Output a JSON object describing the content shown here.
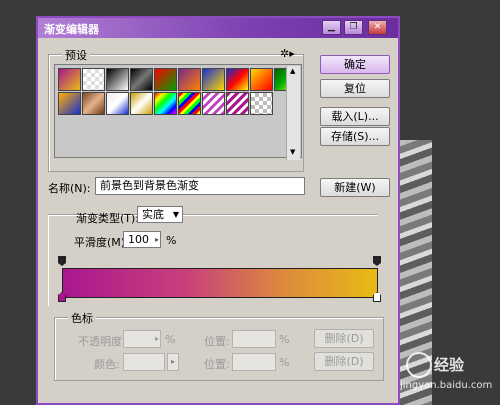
{
  "dialog": {
    "title": "渐变编辑器",
    "titlebar_buttons": [
      "minimize-icon",
      "restore-icon",
      "close-icon"
    ],
    "accent_color": "#7c3fb0"
  },
  "presets": {
    "label": "预设",
    "menu_icon": "gear-icon",
    "swatch_count": 14
  },
  "buttons": {
    "ok": "确定",
    "reset": "复位",
    "load": "载入(L)...",
    "save": "存储(S)...",
    "new": "新建(W)"
  },
  "name": {
    "label": "名称(N):",
    "value": "前景色到背景色渐变"
  },
  "gradient": {
    "type_label": "渐变类型(T):",
    "type_value": "实底",
    "smoothness_label": "平滑度(M):",
    "smoothness_value": "100",
    "smoothness_unit": "%",
    "start_color": "#a8178f",
    "end_color": "#e8bb14"
  },
  "color_stops": {
    "label": "色标",
    "opacity_label": "不透明度:",
    "opacity_unit": "%",
    "location_label_1": "位置:",
    "location_unit_1": "%",
    "delete_label_1": "删除(D)",
    "color_label": "颜色:",
    "location_label_2": "位置:",
    "location_unit_2": "%",
    "delete_label_2": "删除(D)"
  },
  "watermark": {
    "name": "经验",
    "url": "jingyan.baidu.com"
  }
}
